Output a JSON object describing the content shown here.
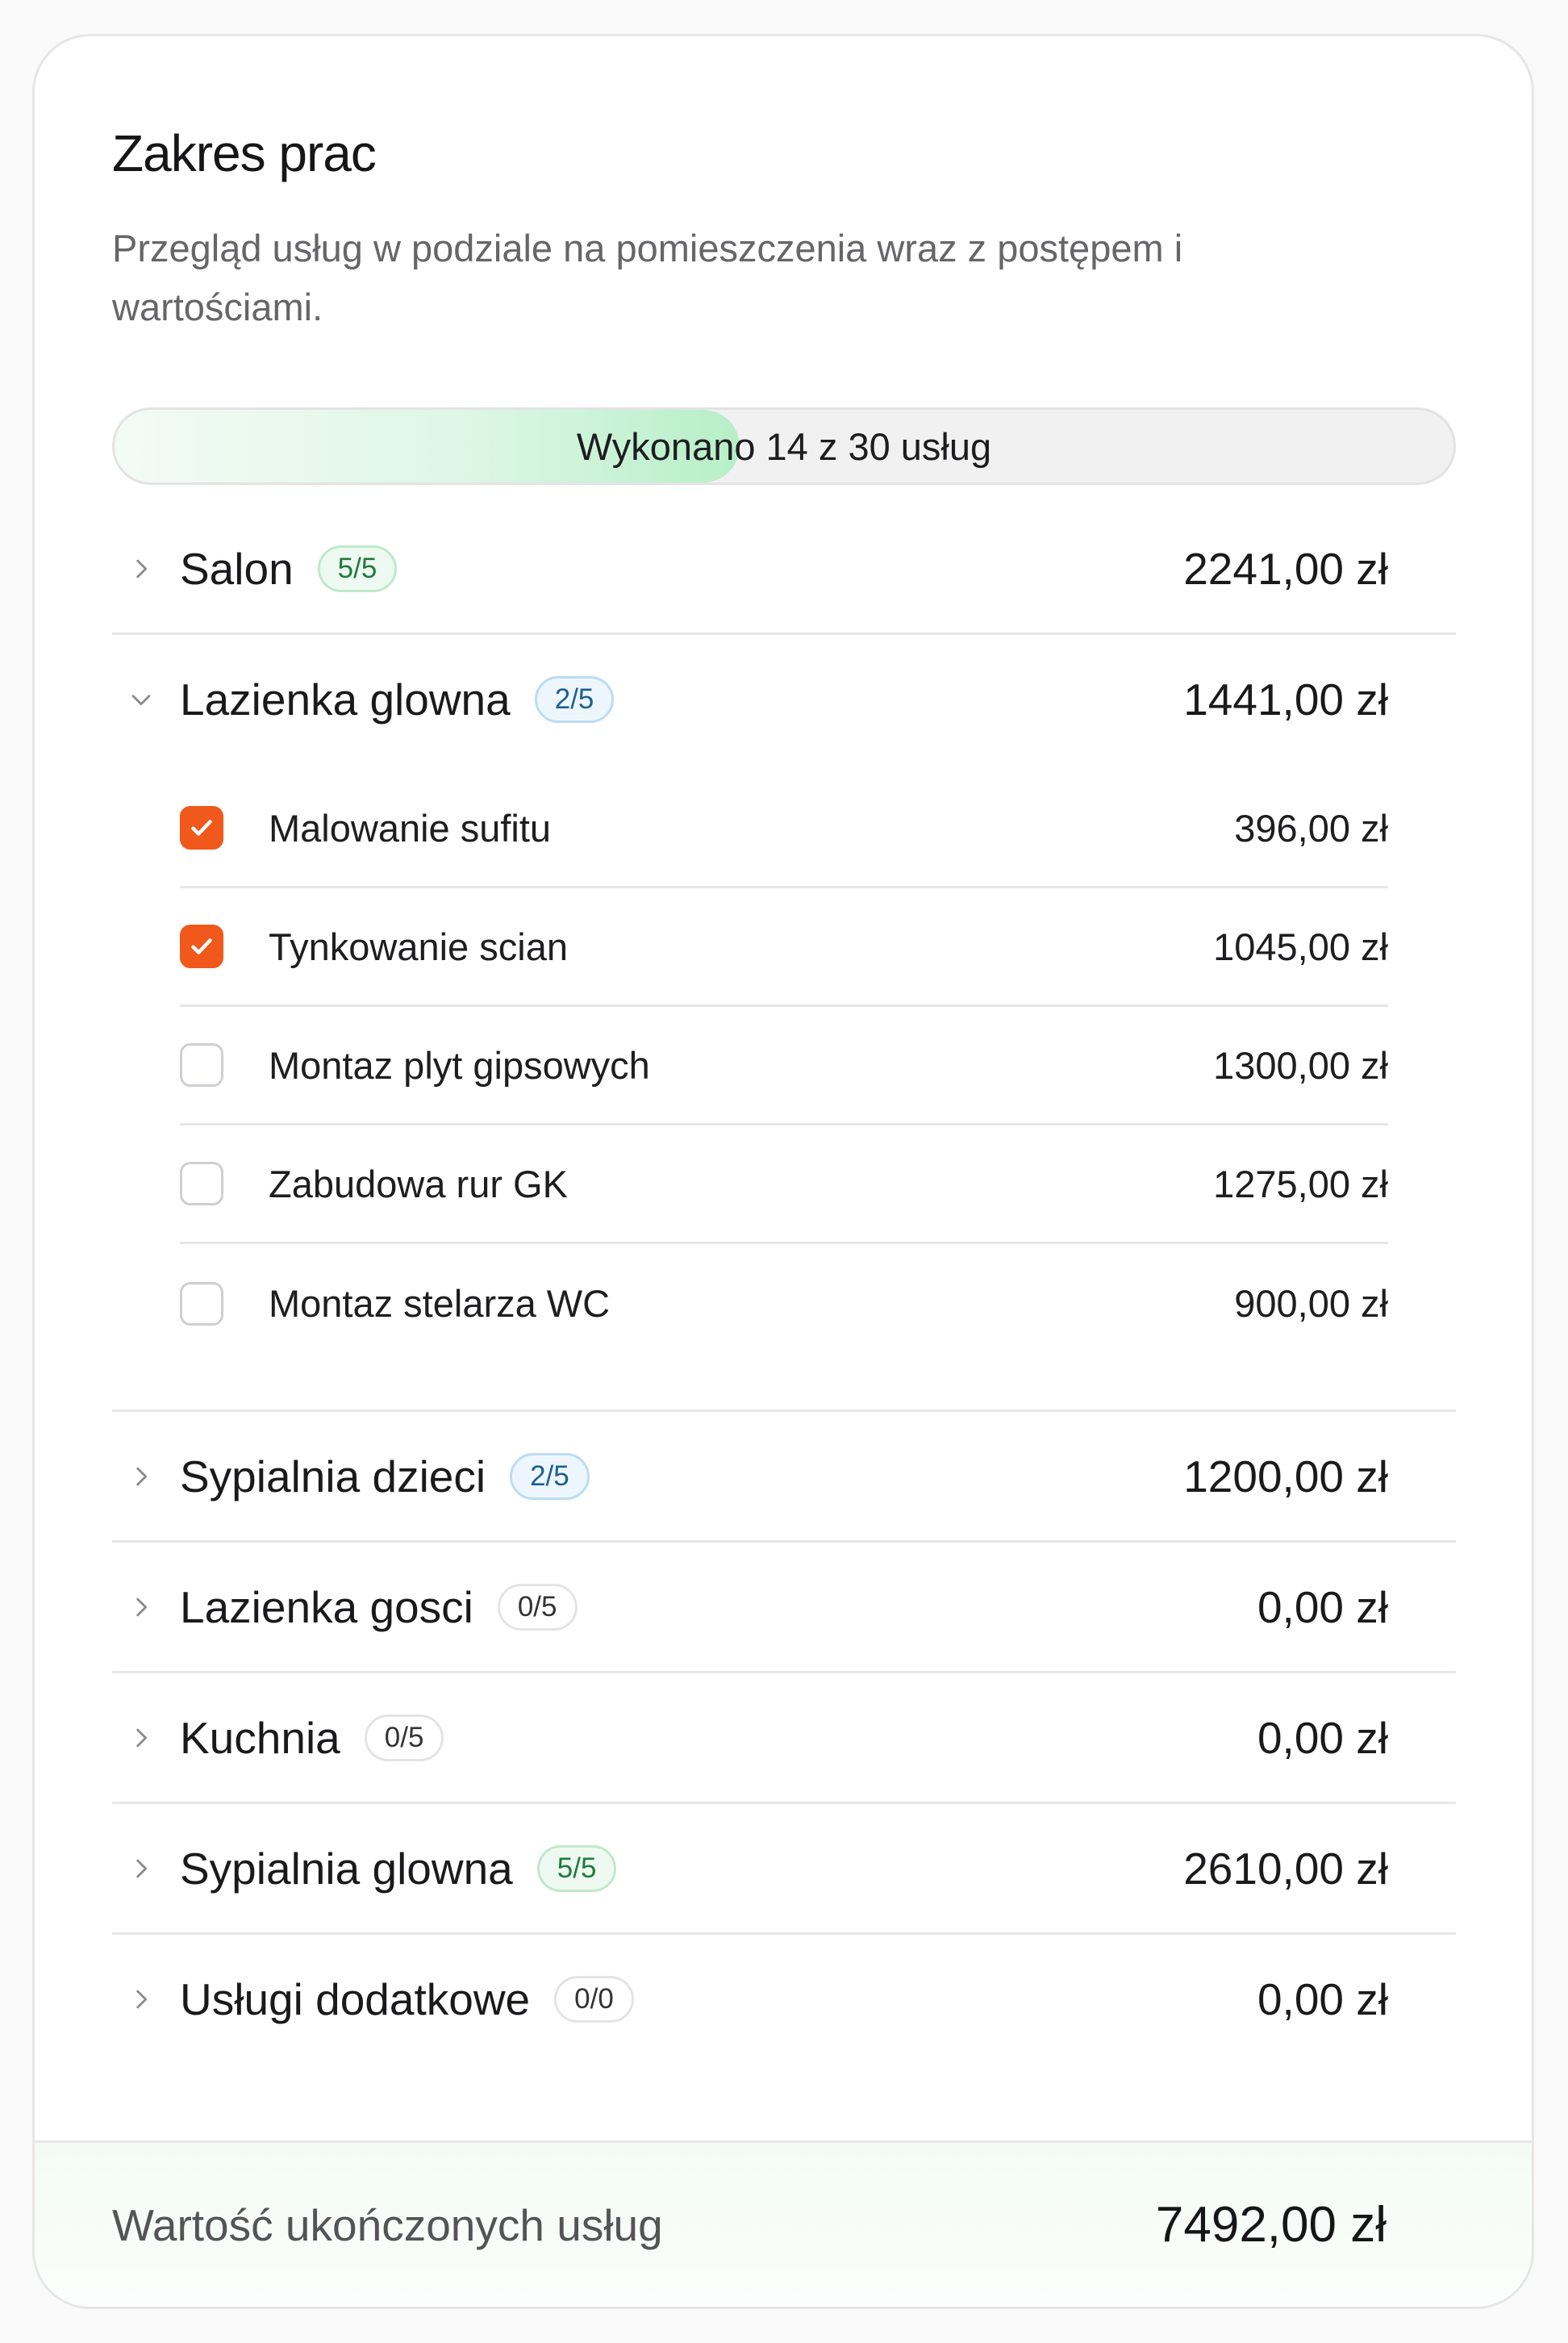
{
  "header": {
    "title": "Zakres prac",
    "subtitle": "Przegląd usług w podziale na pomieszczenia wraz z postępem i wartościami."
  },
  "progress": {
    "label": "Wykonano 14 z 30 usług",
    "done": 14,
    "total": 30
  },
  "rooms": [
    {
      "name": "Salon",
      "badge": "5/5",
      "badge_style": "green",
      "price": "2241,00 zł",
      "expanded": false
    },
    {
      "name": "Lazienka glowna",
      "badge": "2/5",
      "badge_style": "blue",
      "price": "1441,00 zł",
      "expanded": true,
      "items": [
        {
          "name": "Malowanie sufitu",
          "price": "396,00 zł",
          "checked": true
        },
        {
          "name": "Tynkowanie scian",
          "price": "1045,00 zł",
          "checked": true
        },
        {
          "name": "Montaz plyt gipsowych",
          "price": "1300,00 zł",
          "checked": false
        },
        {
          "name": "Zabudowa rur GK",
          "price": "1275,00 zł",
          "checked": false
        },
        {
          "name": "Montaz stelarza WC",
          "price": "900,00 zł",
          "checked": false
        }
      ]
    },
    {
      "name": "Sypialnia dzieci",
      "badge": "2/5",
      "badge_style": "blue",
      "price": "1200,00 zł",
      "expanded": false
    },
    {
      "name": "Lazienka gosci",
      "badge": "0/5",
      "badge_style": "gray",
      "price": "0,00 zł",
      "expanded": false
    },
    {
      "name": "Kuchnia",
      "badge": "0/5",
      "badge_style": "gray",
      "price": "0,00 zł",
      "expanded": false
    },
    {
      "name": "Sypialnia glowna",
      "badge": "5/5",
      "badge_style": "green",
      "price": "2610,00 zł",
      "expanded": false
    },
    {
      "name": "Usługi dodatkowe",
      "badge": "0/0",
      "badge_style": "gray",
      "price": "0,00 zł",
      "expanded": false
    }
  ],
  "footer": {
    "label": "Wartość ukończonych usług",
    "value": "7492,00 zł"
  },
  "icons": {
    "collapsed": "chevron-right-icon",
    "expanded": "chevron-down-icon",
    "check": "checkmark-icon"
  },
  "colors": {
    "accent": "#f0581c",
    "progress_fill": "#b7efc8",
    "badge_green": "#1f7a3d",
    "badge_blue": "#1d5f8f"
  }
}
